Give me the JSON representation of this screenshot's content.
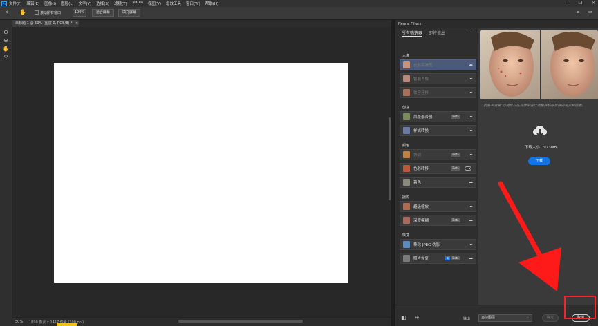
{
  "app": {
    "logo": "Ps",
    "menu": [
      "文件(F)",
      "编辑(E)",
      "图像(I)",
      "图层(L)",
      "文字(Y)",
      "选择(S)",
      "滤镜(T)",
      "3D(D)",
      "视图(V)",
      "增效工具",
      "窗口(W)",
      "帮助(H)"
    ],
    "window_controls": [
      "—",
      "❐",
      "✕"
    ]
  },
  "options": {
    "scroll_all_windows": "滚动所有窗口",
    "zoom_value": "100%",
    "fit_screen": "适合屏幕",
    "fill_screen": "填充屏幕"
  },
  "document": {
    "tab_title": "未标题-1 @ 50% (图层 0, RGB/8) *",
    "tab_close": "×"
  },
  "status": {
    "zoom": "50%",
    "info": "1890 像素 x 1417 像素 (300 ppi)"
  },
  "neural_filters": {
    "panel_title": "Neural Filters",
    "tabs": [
      "所有筛选器",
      "即将推出"
    ],
    "more": "···",
    "sections": [
      {
        "title": "人像",
        "items": [
          {
            "label": "皮肤平滑度",
            "selected": true,
            "dim": true,
            "beta": false
          },
          {
            "label": "智能肖像",
            "selected": false,
            "dim": true,
            "beta": false
          },
          {
            "label": "妆容迁移",
            "selected": false,
            "dim": true,
            "beta": false
          }
        ]
      },
      {
        "title": "创意",
        "items": [
          {
            "label": "风景混合器",
            "selected": false,
            "dim": false,
            "beta": true
          },
          {
            "label": "样式转换",
            "selected": false,
            "dim": false,
            "beta": false
          }
        ]
      },
      {
        "title": "颜色",
        "items": [
          {
            "label": "协调",
            "selected": false,
            "dim": true,
            "beta": true
          },
          {
            "label": "色彩转移",
            "selected": false,
            "dim": false,
            "beta": true,
            "toggle": true
          },
          {
            "label": "着色",
            "selected": false,
            "dim": false,
            "beta": false
          }
        ]
      },
      {
        "title": "摄影",
        "items": [
          {
            "label": "超级缩放",
            "selected": false,
            "dim": false,
            "beta": false
          },
          {
            "label": "深度模糊",
            "selected": false,
            "dim": false,
            "beta": true
          }
        ]
      },
      {
        "title": "恢复",
        "items": [
          {
            "label": "移除 JPEG 伪影",
            "selected": false,
            "dim": false,
            "beta": false
          },
          {
            "label": "照片恢复",
            "selected": false,
            "dim": false,
            "beta": true,
            "new": "新"
          }
        ]
      }
    ],
    "beta_label": "Beta",
    "description": "\"皮肤平滑度\"滤镜可以在肖像中进行调整并移除皮肤的斑点和痘痕。",
    "download_size": "下载大小：973MB",
    "download_button": "下载",
    "output_label": "输出",
    "output_value": "当前图层",
    "ok_button": "确定",
    "cancel_button": "取消"
  },
  "colors": {
    "accent": "#1473e6",
    "annotation": "#ff2020"
  }
}
